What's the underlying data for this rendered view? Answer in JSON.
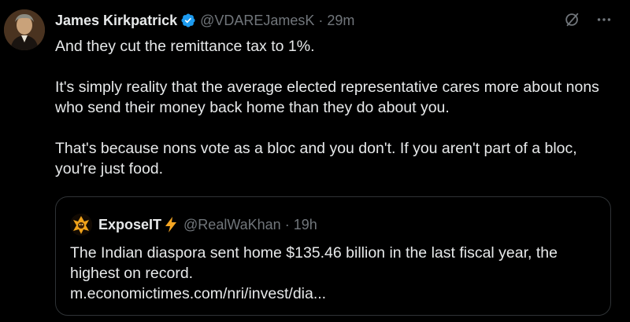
{
  "tweet": {
    "author": {
      "display_name": "James Kirkpatrick",
      "handle": "@VDAREJamesK",
      "verified": true,
      "avatar_icon": "avatar-portrait"
    },
    "separator": "·",
    "time": "29m",
    "actions": {
      "grok_icon": "grok-icon",
      "more_icon": "more-options-icon"
    },
    "paragraphs": [
      "And they cut the remittance tax to 1%.",
      "It's simply reality that the average elected representative cares more about nons who send their money back home than they do about you.",
      "That's because nons vote as a bloc and you don't. If you aren't part of a bloc, you're just food."
    ]
  },
  "quote": {
    "author": {
      "display_name": "ExposeIT",
      "emoji": "⚡",
      "handle": "@RealWaKhan",
      "avatar_icon": "avatar-logo"
    },
    "separator": "·",
    "time": "19h",
    "text": "The Indian diaspora sent home $135.46 billion in the last fiscal year, the highest on record.",
    "link": "m.economictimes.com/nri/invest/dia..."
  },
  "colors": {
    "background": "#000000",
    "text": "#e7e9ea",
    "secondary": "#71767b",
    "border": "#2f3336",
    "verified": "#1d9bf0",
    "lightning": "#f5a623"
  }
}
